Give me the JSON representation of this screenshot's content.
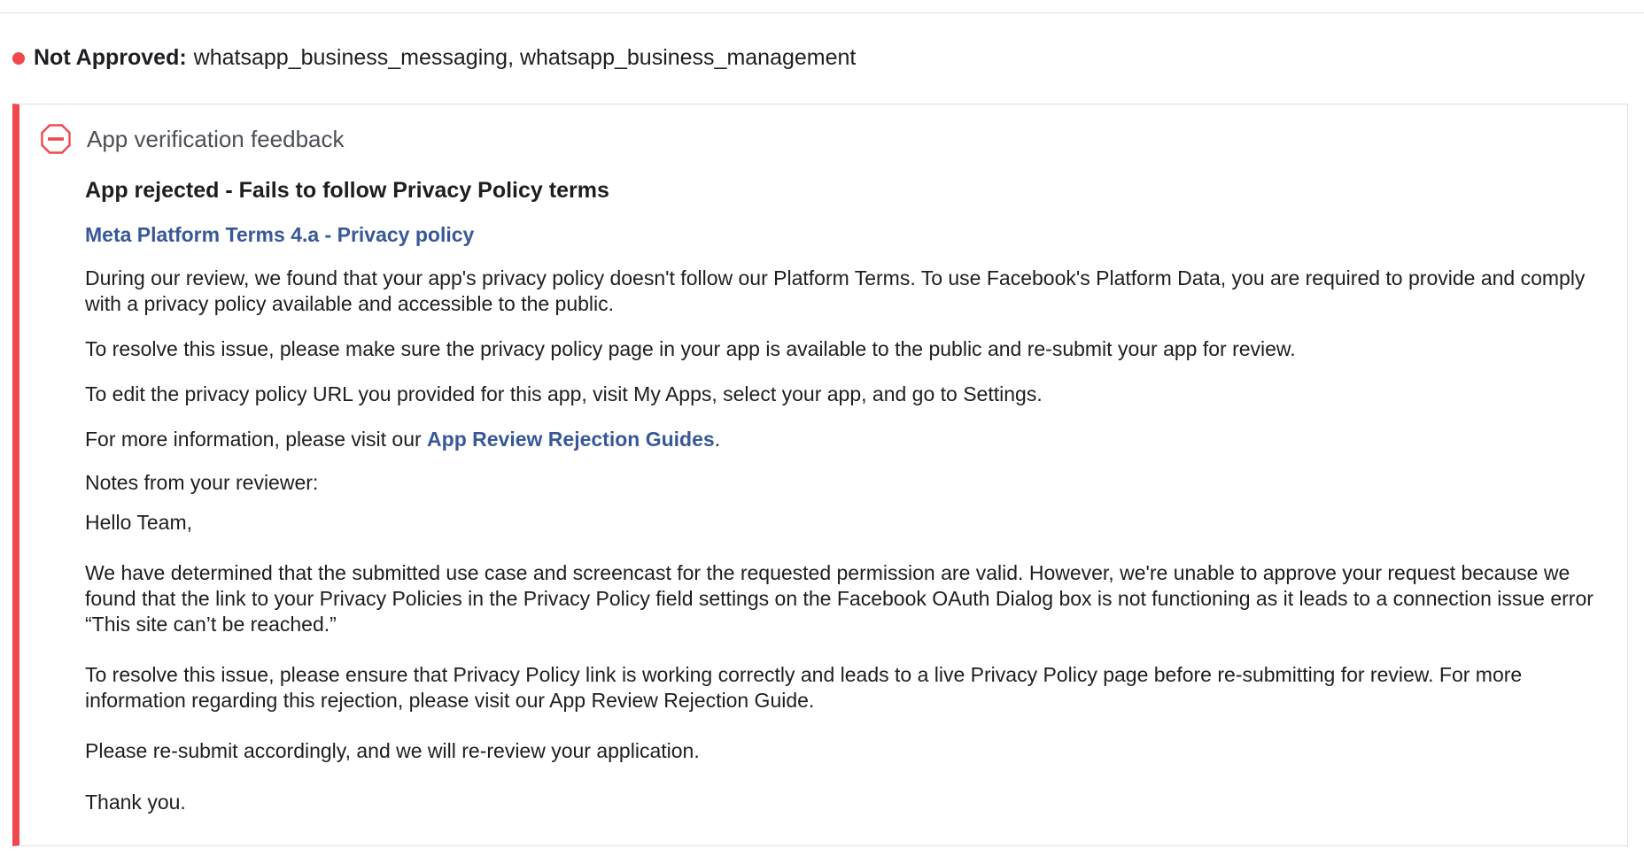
{
  "status": {
    "label": "Not Approved:",
    "permissions": "whatsapp_business_messaging, whatsapp_business_management",
    "dot_color": "#f0494d"
  },
  "feedback": {
    "title": "App verification feedback",
    "icon": "stop-icon",
    "rejection_title": "App rejected - Fails to follow Privacy Policy terms",
    "terms_link": "Meta Platform Terms 4.a - Privacy policy",
    "paragraphs": [
      "During our review, we found that your app's privacy policy doesn't follow our Platform Terms. To use Facebook's Platform Data, you are required to provide and comply with a privacy policy available and accessible to the public.",
      "To resolve this issue, please make sure the privacy policy page in your app is available to the public and re-submit your app for review.",
      "To edit the privacy policy URL you provided for this app, visit My Apps, select your app, and go to Settings."
    ],
    "more_info_prefix": "For more information, please visit our ",
    "more_info_link": "App Review Rejection Guides",
    "more_info_suffix": ".",
    "notes_label": "Notes from your reviewer:",
    "reviewer_notes": "Hello Team,\n\nWe have determined that the submitted use case and screencast for the requested permission are valid. However, we're unable to approve your request because we found that the link to your Privacy Policies in the Privacy Policy field settings on the Facebook OAuth Dialog box is not functioning as it leads to a connection issue error “This site can’t be reached.”\n\nTo resolve this issue, please ensure that Privacy Policy link is working correctly and leads to a live Privacy Policy page before re-submitting for review. For more information regarding this rejection, please visit our App Review Rejection Guide.\n\nPlease re-submit accordingly, and we will re-review your application.\n\nThank you."
  },
  "colors": {
    "accent_red": "#f0494d",
    "link_blue": "#385898",
    "text": "#1c1e21",
    "muted": "#4b4f56"
  }
}
